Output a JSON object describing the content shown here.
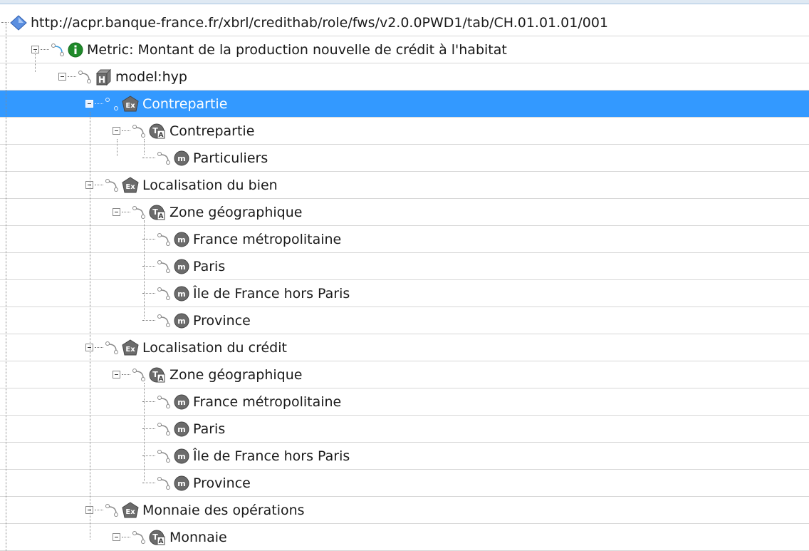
{
  "tree": {
    "root": {
      "label": "http://acpr.banque-france.fr/xbrl/credithab/role/fws/v2.0.0PWD1/tab/CH.01.01.01/001",
      "icon": "diamond-icon"
    },
    "metric": {
      "label": "Metric: Montant de la production nouvelle de crédit à l'habitat",
      "icon": "info-icon"
    },
    "hypercube": {
      "label": "model:hyp",
      "icon": "hypercube-icon"
    },
    "groups": [
      {
        "label": "Contrepartie",
        "icon": "explicit-dimension-icon",
        "selected": true,
        "axis": "Contrepartie",
        "members": [
          "Particuliers"
        ]
      },
      {
        "label": "Localisation du bien",
        "icon": "explicit-dimension-icon",
        "axis": "Zone géographique",
        "members": [
          "France métropolitaine",
          "Paris",
          "Île de France hors Paris",
          "Province"
        ]
      },
      {
        "label": "Localisation du crédit",
        "icon": "explicit-dimension-icon",
        "axis": "Zone géographique",
        "members": [
          "France métropolitaine",
          "Paris",
          "Île de France hors Paris",
          "Province"
        ]
      },
      {
        "label": "Monnaie des opérations",
        "icon": "explicit-dimension-icon",
        "axis": "Monnaie",
        "members": []
      }
    ]
  },
  "colors": {
    "selection": "#3399ff",
    "metric_icon": "#1f8a2a",
    "diamond": "#4a7fd8",
    "node_icon": "#6b6b6b"
  }
}
